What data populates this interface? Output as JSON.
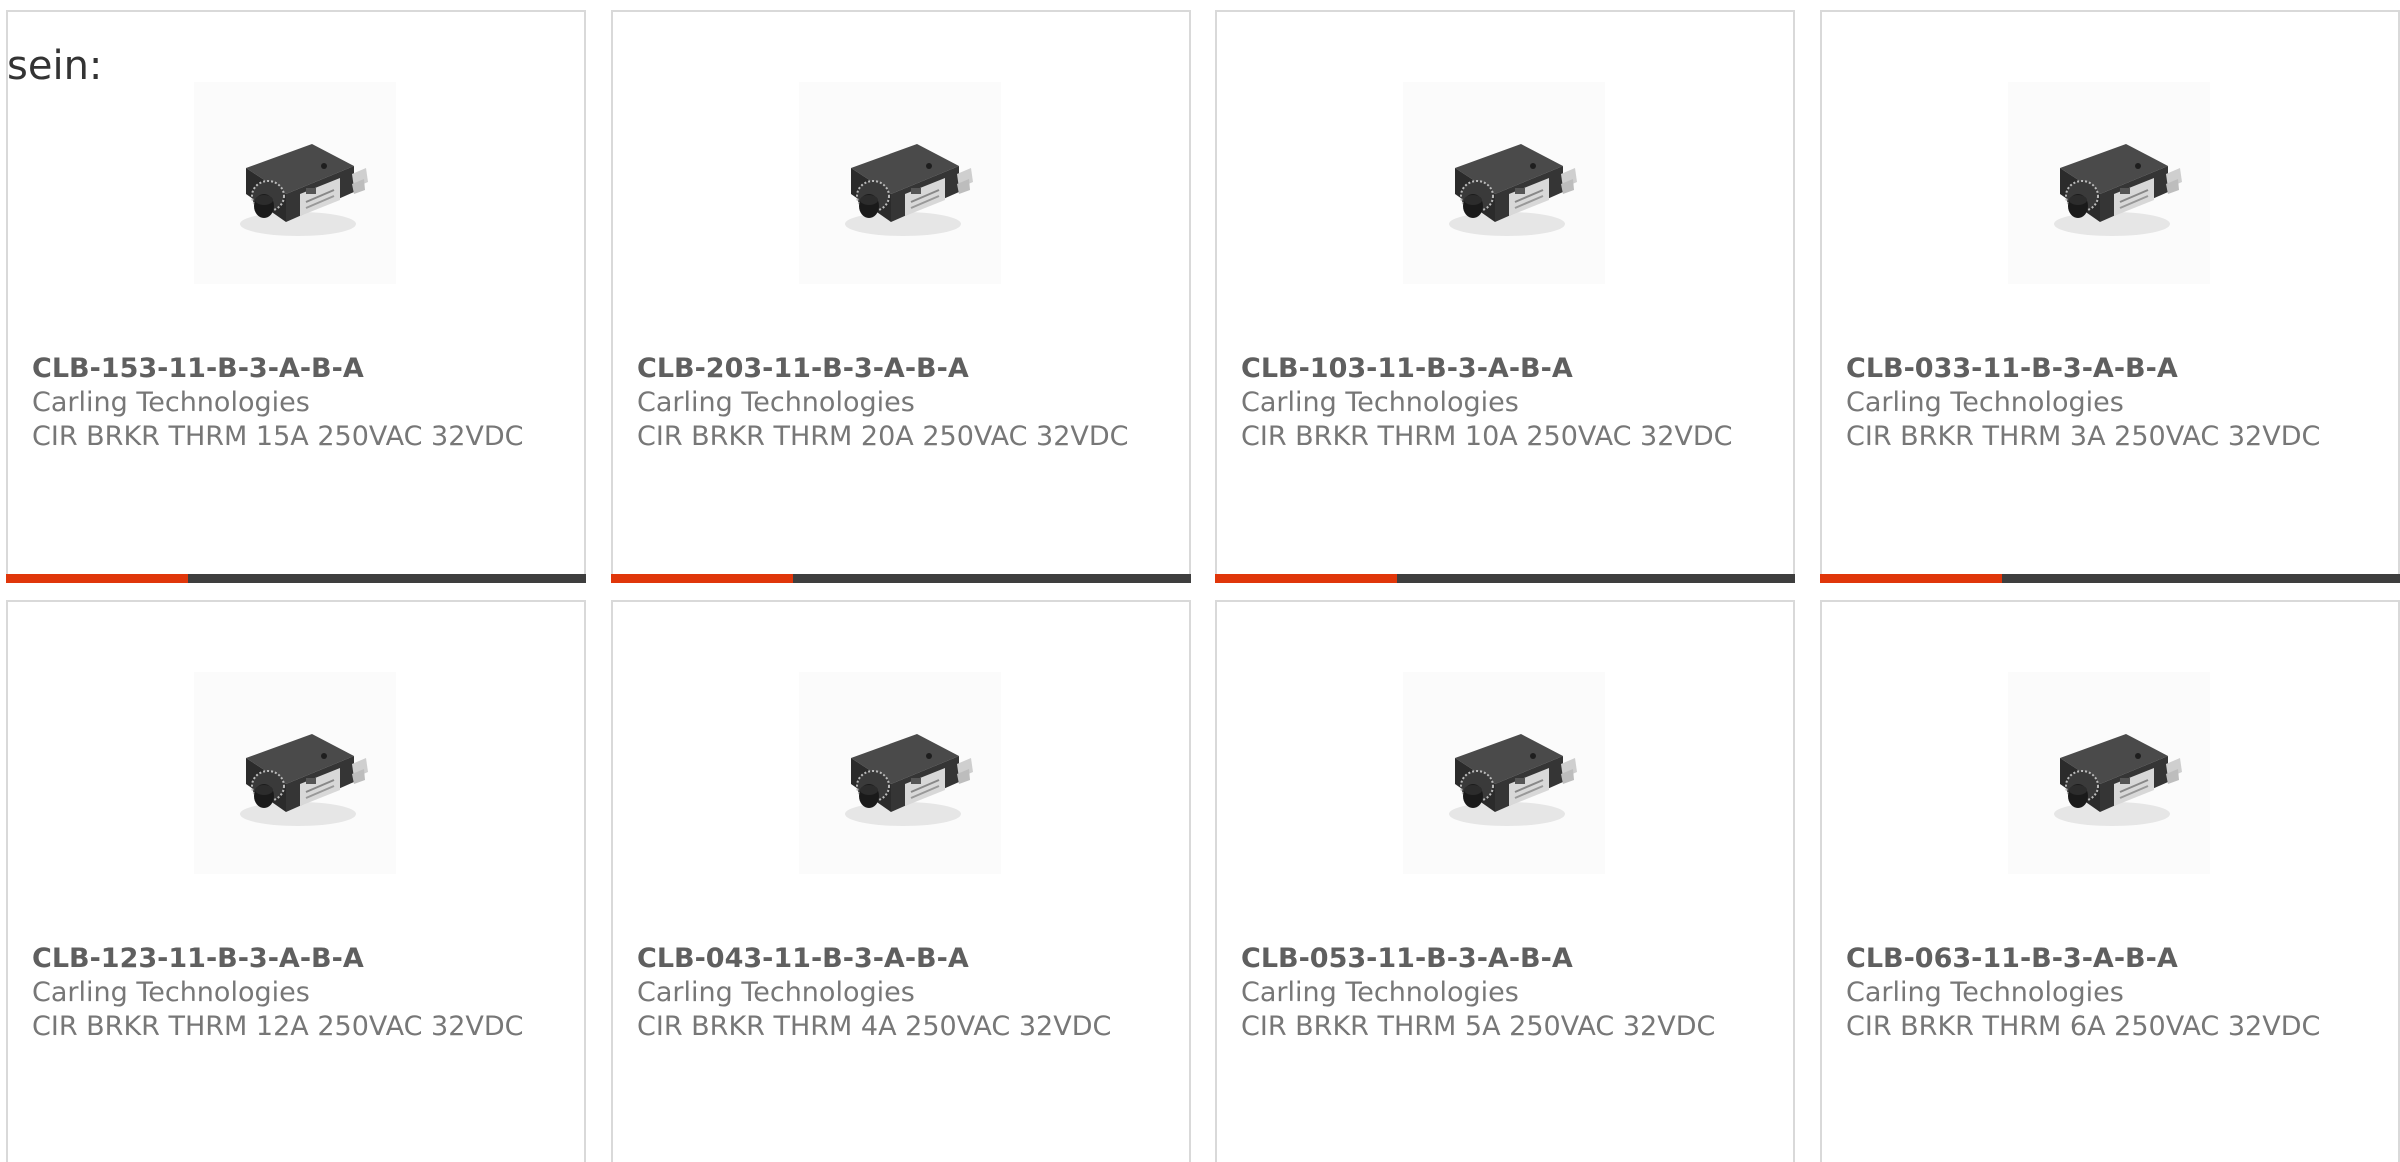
{
  "intro_text": "sein:",
  "colors": {
    "accent": "#e0360a",
    "bar": "#3e3e3e",
    "card_border": "#d9d9d9",
    "text": "#777777"
  },
  "products": [
    {
      "part_number": "CLB-153-11-B-3-A-B-A",
      "manufacturer": "Carling Technologies",
      "description": "CIR BRKR THRM 15A 250VAC 32VDC",
      "image_icon": "circuit-breaker-photo"
    },
    {
      "part_number": "CLB-203-11-B-3-A-B-A",
      "manufacturer": "Carling Technologies",
      "description": "CIR BRKR THRM 20A 250VAC 32VDC",
      "image_icon": "circuit-breaker-photo"
    },
    {
      "part_number": "CLB-103-11-B-3-A-B-A",
      "manufacturer": "Carling Technologies",
      "description": "CIR BRKR THRM 10A 250VAC 32VDC",
      "image_icon": "circuit-breaker-photo"
    },
    {
      "part_number": "CLB-033-11-B-3-A-B-A",
      "manufacturer": "Carling Technologies",
      "description": "CIR BRKR THRM 3A 250VAC 32VDC",
      "image_icon": "circuit-breaker-photo"
    },
    {
      "part_number": "CLB-123-11-B-3-A-B-A",
      "manufacturer": "Carling Technologies",
      "description": "CIR BRKR THRM 12A 250VAC 32VDC",
      "image_icon": "circuit-breaker-photo"
    },
    {
      "part_number": "CLB-043-11-B-3-A-B-A",
      "manufacturer": "Carling Technologies",
      "description": "CIR BRKR THRM 4A 250VAC 32VDC",
      "image_icon": "circuit-breaker-photo"
    },
    {
      "part_number": "CLB-053-11-B-3-A-B-A",
      "manufacturer": "Carling Technologies",
      "description": "CIR BRKR THRM 5A 250VAC 32VDC",
      "image_icon": "circuit-breaker-photo"
    },
    {
      "part_number": "CLB-063-11-B-3-A-B-A",
      "manufacturer": "Carling Technologies",
      "description": "CIR BRKR THRM 6A 250VAC 32VDC",
      "image_icon": "circuit-breaker-photo"
    }
  ]
}
